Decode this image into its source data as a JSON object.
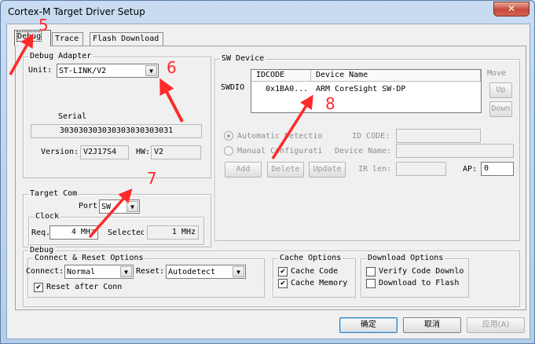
{
  "window": {
    "title": "Cortex-M Target Driver Setup",
    "close_glyph": "✕"
  },
  "tabs": [
    {
      "label": "Debug",
      "active": true
    },
    {
      "label": "Trace",
      "active": false
    },
    {
      "label": "Flash Download",
      "active": false
    }
  ],
  "debug_adapter": {
    "group_label": "Debug Adapter",
    "unit_label": "Unit:",
    "unit_value": "ST-LINK/V2",
    "serial_label": "Serial",
    "serial_value": "303030303030303030303031",
    "version_label": "Version:",
    "version_value": "V2J17S4",
    "hw_label": "HW:",
    "hw_value": "V2"
  },
  "target_com": {
    "group_label": "Target Com",
    "port_label": "Port",
    "port_value": "SW",
    "clock_label": "Clock",
    "req_label": "Req.",
    "req_value": "4 MHz",
    "selected_label": "Selected",
    "selected_value": "1 MHz"
  },
  "sw_device": {
    "group_label": "SW Device",
    "swdio_label": "SWDIO",
    "col_idcode": "IDCODE",
    "col_device": "Device Name",
    "row_idcode": "0x1BA0...",
    "row_device": "ARM CoreSight SW-DP",
    "move_label": "Move",
    "up_label": "Up",
    "down_label": "Down",
    "auto_detect_label": "Automatic Detectio",
    "manual_config_label": "Manual Configurati",
    "id_code_label": "ID CODE:",
    "device_name_label": "Device Name:",
    "add_label": "Add",
    "delete_label": "Delete",
    "update_label": "Update",
    "ir_len_label": "IR len:",
    "ap_label": "AP:",
    "ap_value": "0"
  },
  "debug_options": {
    "group_label": "Debug",
    "connect_group_label": "Connect & Reset Options",
    "connect_label": "Connect:",
    "connect_value": "Normal",
    "reset_label": "Reset:",
    "reset_value": "Autodetect",
    "reset_after_conn_label": "Reset after Conn",
    "cache_group_label": "Cache Options",
    "cache_code_label": "Cache Code",
    "cache_memory_label": "Cache Memory",
    "download_group_label": "Download Options",
    "verify_code_label": "Verify Code Downlo",
    "download_flash_label": "Download to Flash",
    "check_glyph": "✔"
  },
  "footer": {
    "ok_label": "确定",
    "cancel_label": "取消",
    "apply_label": "应用(A)"
  },
  "annotations": {
    "n5": "5",
    "n6": "6",
    "n7": "7",
    "n8": "8",
    "color": "#ff2a2a"
  }
}
